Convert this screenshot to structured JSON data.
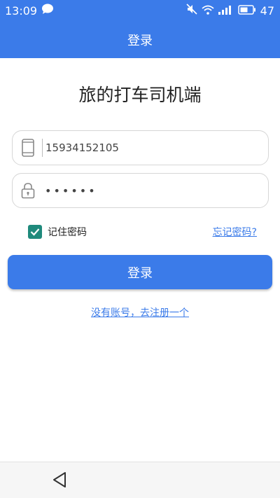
{
  "status": {
    "time": "13:09",
    "battery": "47"
  },
  "header": {
    "title": "登录"
  },
  "app": {
    "name": "旅的打车司机端"
  },
  "form": {
    "phone_value": "15934152105",
    "password_value": "••••••",
    "remember_label": "记住密码",
    "forgot_label": "忘记密码?",
    "login_label": "登录",
    "register_label": "没有账号，去注册一个"
  },
  "colors": {
    "accent": "#3b7be9",
    "checkbox": "#1f8a7c"
  },
  "icons": [
    "chat-icon",
    "mute-icon",
    "wifi-icon",
    "signal-icon",
    "battery-icon",
    "phone-icon",
    "lock-icon",
    "check-icon",
    "back-icon"
  ]
}
